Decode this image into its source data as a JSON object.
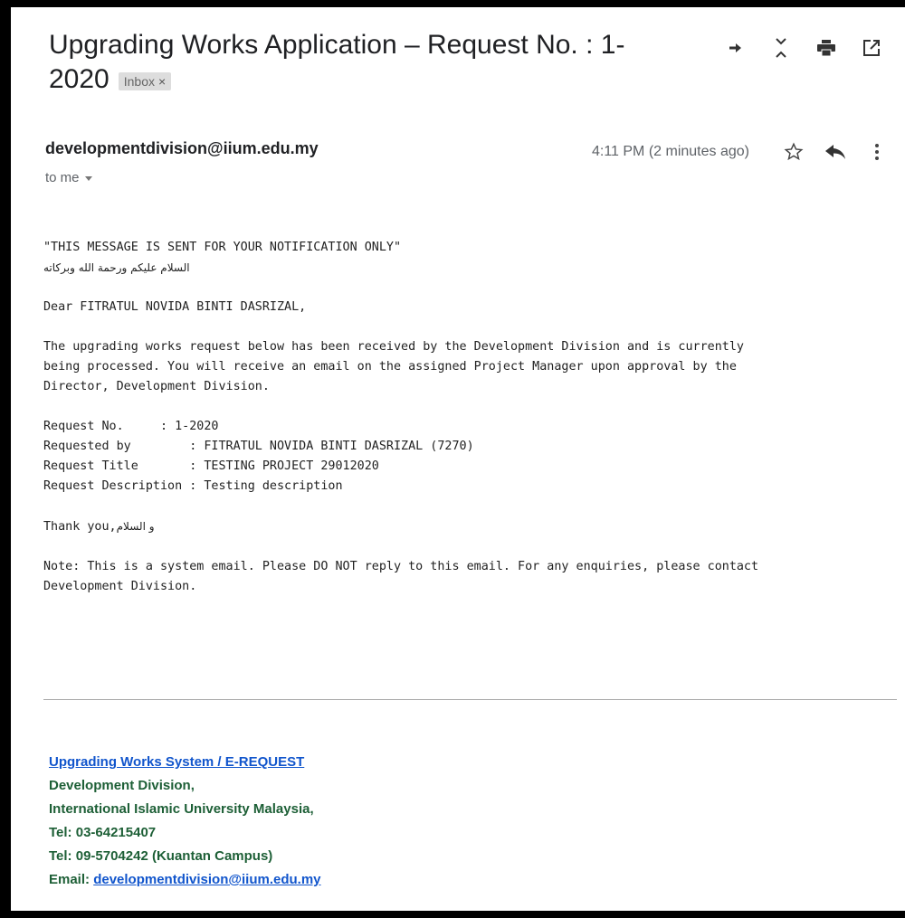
{
  "email": {
    "subject": "Upgrading Works Application – Request No. : 1-2020",
    "label_chip": "Inbox",
    "label_chip_close": "×",
    "sender": "developmentdivision@iium.edu.my",
    "recipient_summary": "to me",
    "time": "4:11 PM (2 minutes ago)"
  },
  "toolbar": {
    "icons": [
      "move-icon",
      "collapse-icon",
      "print-icon",
      "open-new-window-icon"
    ]
  },
  "message_actions": {
    "icons": [
      "star-icon",
      "reply-icon",
      "more-vert-icon"
    ]
  },
  "body": {
    "notice": "\"THIS MESSAGE IS SENT FOR YOUR NOTIFICATION ONLY\"",
    "greeting_arabic": "السلام عليكم ورحمة الله وبركاته",
    "salutation": "Dear FITRATUL NOVIDA BINTI DASRIZAL,",
    "paragraph": "The upgrading works request below has been received by the Development Division and is currently\nbeing processed. You will receive an email on the assigned Project Manager upon approval by the\nDirector, Development Division.",
    "fields": [
      {
        "label": "Request No.     ",
        "value": ": 1-2020"
      },
      {
        "label": "Requested by        ",
        "value": ": FITRATUL NOVIDA BINTI DASRIZAL (7270)"
      },
      {
        "label": "Request Title       ",
        "value": ": TESTING PROJECT 29012020"
      },
      {
        "label": "Request Description ",
        "value": ": Testing description"
      }
    ],
    "thanks": "Thank you,",
    "thanks_arabic": "و السلام",
    "note": "Note: This is a system email. Please DO NOT reply to this email. For any enquiries, please contact\nDevelopment Division."
  },
  "signature": {
    "system_link": "Upgrading Works System / E-REQUEST",
    "line1": "Development Division,",
    "line2": "International Islamic University Malaysia,",
    "tel1": "Tel: 03-64215407",
    "tel2": "Tel: 09-5704242 (Kuantan Campus)",
    "email_label": "Email: ",
    "email_link": "developmentdivision@iium.edu.my"
  }
}
